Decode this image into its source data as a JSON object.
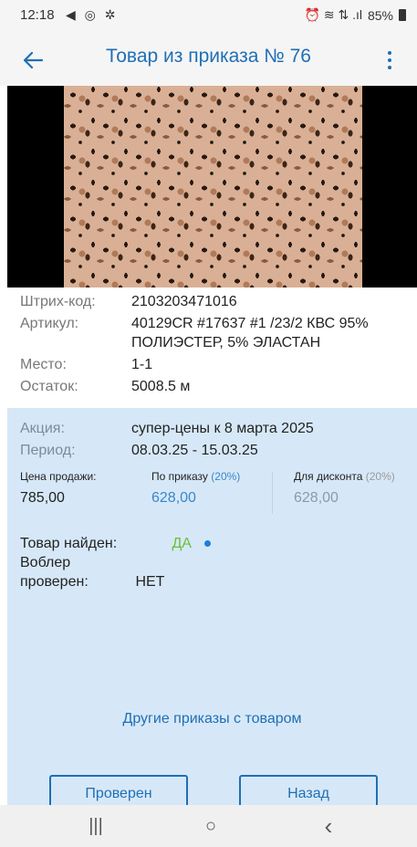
{
  "status_bar": {
    "time": "12:18",
    "left_icons": "◀ ◎ ✲",
    "right_icons": "⏰ ≋ ⇅ .ıl",
    "battery": "85%"
  },
  "app_bar": {
    "title": "Товар из приказа № 76",
    "accent_color": "#1f6fb5"
  },
  "product": {
    "image_alt": "leopard-print fabric"
  },
  "info": {
    "rows": [
      {
        "label": "Штрих-код:",
        "value": "2103203471016"
      },
      {
        "label": "Артикул:",
        "value": "40129CR #17637 #1 /23/2 КВС 95% ПОЛИЭСТЕР, 5% ЭЛАСТАН"
      },
      {
        "label": "Место:",
        "value": "1-1"
      },
      {
        "label": "Остаток:",
        "value": "5008.5 м"
      }
    ]
  },
  "promo": {
    "action_label": "Акция:",
    "action_value": "супер-цены к 8 марта 2025",
    "period_label": "Период:",
    "period_value": "08.03.25 - 15.03.25",
    "prices": {
      "sale_caption": "Цена продажи:",
      "sale_value": "785,00",
      "order_caption": "По приказу",
      "order_pct": "(20%)",
      "order_value": "628,00",
      "discount_caption": "Для дисконта",
      "discount_pct": "(20%)",
      "discount_value": "628,00"
    },
    "found_label": "Товар найден:",
    "found_value": "ДА",
    "wobbler_label": "Воблер проверен:",
    "wobbler_value": "НЕТ",
    "other_orders_link": "Другие приказы с товаром",
    "checked_button": "Проверен",
    "back_button": "Назад",
    "bg_color": "#d6e8f8"
  },
  "nav_bar": {
    "recents": "|||",
    "home": "○",
    "back": "‹"
  }
}
